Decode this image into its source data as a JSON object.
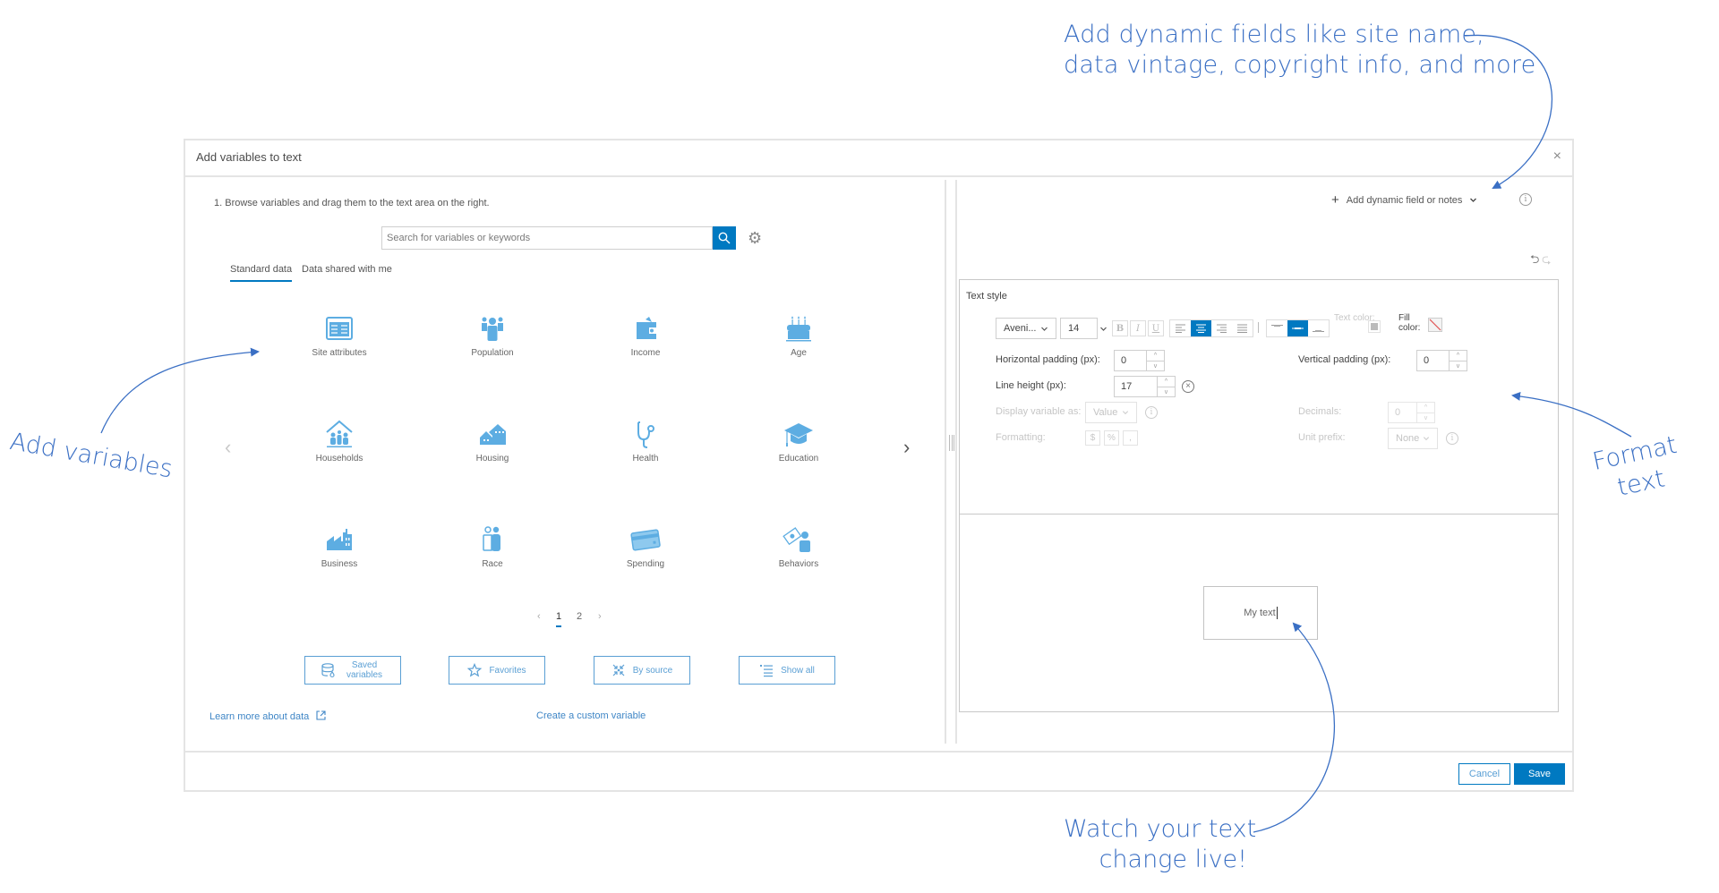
{
  "annotations": {
    "top": [
      "Add dynamic fields like site name,",
      "data vintage, copyright info, and more"
    ],
    "left": "Add variables",
    "right": [
      "Format",
      "text"
    ],
    "bottom": [
      "Watch your text",
      "change live!"
    ]
  },
  "dialog": {
    "title": "Add variables to text",
    "close_label": "×",
    "footer": {
      "cancel_label": "Cancel",
      "save_label": "Save"
    }
  },
  "browse": {
    "instruction": "1.  Browse variables and drag them to the text area on the right.",
    "search_placeholder": "Search for variables or keywords",
    "tabs": [
      {
        "label": "Standard data",
        "active": true
      },
      {
        "label": "Data shared with me",
        "active": false
      }
    ],
    "categories": [
      {
        "label": "Site attributes",
        "icon": "site-attributes-icon"
      },
      {
        "label": "Population",
        "icon": "population-icon"
      },
      {
        "label": "Income",
        "icon": "wallet-icon"
      },
      {
        "label": "Age",
        "icon": "birthday-cake-icon"
      },
      {
        "label": "Households",
        "icon": "household-icon"
      },
      {
        "label": "Housing",
        "icon": "house-icon"
      },
      {
        "label": "Health",
        "icon": "stethoscope-icon"
      },
      {
        "label": "Education",
        "icon": "graduation-cap-icon"
      },
      {
        "label": "Business",
        "icon": "factory-icon"
      },
      {
        "label": "Race",
        "icon": "people-icon"
      },
      {
        "label": "Spending",
        "icon": "credit-card-icon"
      },
      {
        "label": "Behaviors",
        "icon": "behaviors-icon"
      }
    ],
    "pagination": {
      "prev": "‹",
      "pages": [
        "1",
        "2"
      ],
      "current": "1",
      "next": "›"
    },
    "tool_buttons": [
      {
        "label": "Saved variables",
        "icon": "database-icon"
      },
      {
        "label": "Favorites",
        "icon": "star-icon"
      },
      {
        "label": "By source",
        "icon": "compress-icon"
      },
      {
        "label": "Show all",
        "icon": "list-icon"
      }
    ],
    "links": {
      "learn_more": "Learn more about data",
      "custom_variable": "Create a custom variable"
    }
  },
  "editor": {
    "dynamic_field_label": "Add dynamic field or notes",
    "text_style": {
      "title": "Text style",
      "font": "Aveni...",
      "font_size": "14",
      "format_buttons": [
        "B",
        "I",
        "U"
      ],
      "align_active": "center",
      "valign_active": "middle",
      "text_color_label": "Text color:",
      "fill_color_label": "Fill color:",
      "horizontal_padding_label": "Horizontal padding (px):",
      "horizontal_padding": "0",
      "vertical_padding_label": "Vertical padding (px):",
      "vertical_padding": "0",
      "line_height_label": "Line height (px):",
      "line_height": "17",
      "display_as_label": "Display variable as:",
      "display_as": "Value",
      "decimals_label": "Decimals:",
      "decimals": "0",
      "formatting_label": "Formatting:",
      "formatting_buttons": [
        "$",
        "%",
        ","
      ],
      "unit_prefix_label": "Unit prefix:",
      "unit_prefix": "None"
    },
    "preview_text": "My text"
  },
  "colors": {
    "accent": "#0079c1",
    "icon": "#5dade2",
    "annotation": "#3a6fc4"
  }
}
